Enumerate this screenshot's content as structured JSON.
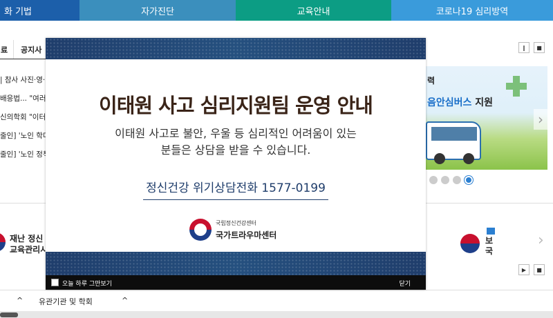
{
  "topnav": {
    "tabs": [
      {
        "label": "화 기법"
      },
      {
        "label": "자가진단"
      },
      {
        "label": "교육안내"
      },
      {
        "label": "코로나19 심리방역"
      }
    ]
  },
  "background": {
    "tabs": [
      "료",
      "공지사"
    ],
    "list": [
      "| 참사 사진·영·",
      "배응법... \"여러",
      "신의학회 \"이터",
      "줄인] '노인 학대",
      "줄인] '노인 정책"
    ],
    "pause_icon": "‖",
    "stop_icon": "■",
    "play_icon": "▶",
    "banner": {
      "text_a": "력",
      "text_b_prefix": "음안심버스",
      "text_b_suffix": " 지원"
    },
    "right_arrow": "›",
    "left_logo_line1": "재난 정신",
    "left_logo_line2": "교육관리시",
    "right_logo_line1": "보",
    "right_logo_line2": "국",
    "bottom_bar": {
      "item1_caret": "^",
      "item2_label": "유관기관 및 학회",
      "item2_caret": "^"
    }
  },
  "modal": {
    "title": "이태원 사고 심리지원팀 운영 안내",
    "desc_line1": "이태원 사고로 불안, 우울 등 심리적인 어려움이 있는",
    "desc_line2": "분들은 상담을 받을 수 있습니다.",
    "phone": "정신건강 위기상담전화 1577-0199",
    "org_small": "국립정신건강센터",
    "org_name": "국가트라우마센터",
    "footer": {
      "checkbox_label": "오늘 하루 그만보기",
      "close_label": "닫기"
    }
  },
  "colors": {
    "nav1": "#1c5faa",
    "nav2": "#3b8fbd",
    "nav3": "#0c9d84",
    "nav4": "#3a9bdb",
    "modal_navy": "#1f3d6b",
    "title_brown": "#3a2418"
  }
}
